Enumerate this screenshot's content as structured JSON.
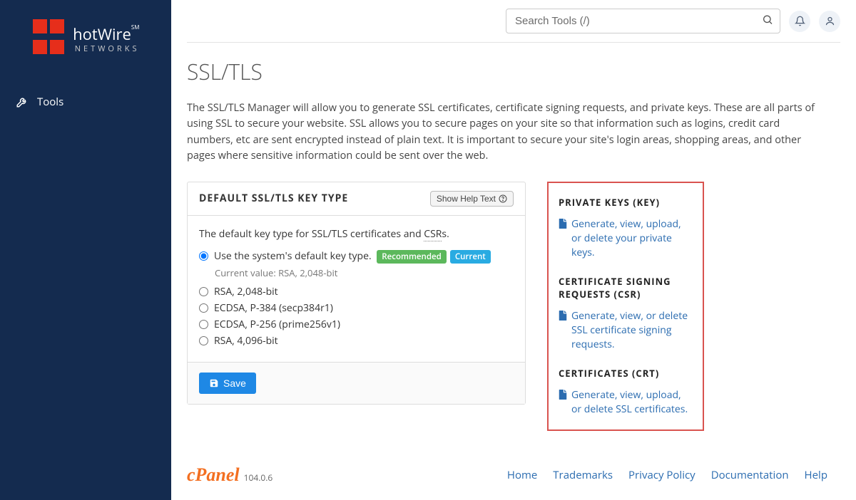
{
  "sidebar": {
    "brand_main": "hotWire",
    "brand_sm": "SM",
    "brand_sub": "NETWORKS",
    "nav": {
      "tools": "Tools"
    }
  },
  "topbar": {
    "search_placeholder": "Search Tools (/)"
  },
  "page": {
    "title": "SSL/TLS",
    "intro": "The SSL/TLS Manager will allow you to generate SSL certificates, certificate signing requests, and private keys. These are all parts of using SSL to secure your website. SSL allows you to secure pages on your site so that information such as logins, credit card numbers, etc are sent encrypted instead of plain text. It is important to secure your site's login areas, shopping areas, and other pages where sensitive information could be sent over the web."
  },
  "keytype_panel": {
    "heading": "DEFAULT SSL/TLS KEY TYPE",
    "help_btn": "Show Help Text",
    "desc_pre": "The default key type for SSL/TLS certificates and ",
    "desc_dotted": "CSR",
    "desc_post": "s.",
    "badge_recommended": "Recommended",
    "badge_current": "Current",
    "current_value_label": "Current value: RSA, 2,048-bit",
    "options": [
      "Use the system's default key type.",
      "RSA, 2,048-bit",
      "ECDSA, P-384 (secp384r1)",
      "ECDSA, P-256 (prime256v1)",
      "RSA, 4,096-bit"
    ],
    "save": "Save"
  },
  "right": {
    "key_title": "PRIVATE KEYS (KEY)",
    "key_link": "Generate, view, upload, or delete your private keys.",
    "csr_title": "CERTIFICATE SIGNING REQUESTS (CSR)",
    "csr_link": "Generate, view, or delete SSL certificate signing requests.",
    "crt_title": "CERTIFICATES (CRT)",
    "crt_link": "Generate, view, upload, or delete SSL certificates."
  },
  "footer": {
    "brand": "cPanel",
    "version": "104.0.6",
    "links": [
      "Home",
      "Trademarks",
      "Privacy Policy",
      "Documentation",
      "Help"
    ]
  }
}
